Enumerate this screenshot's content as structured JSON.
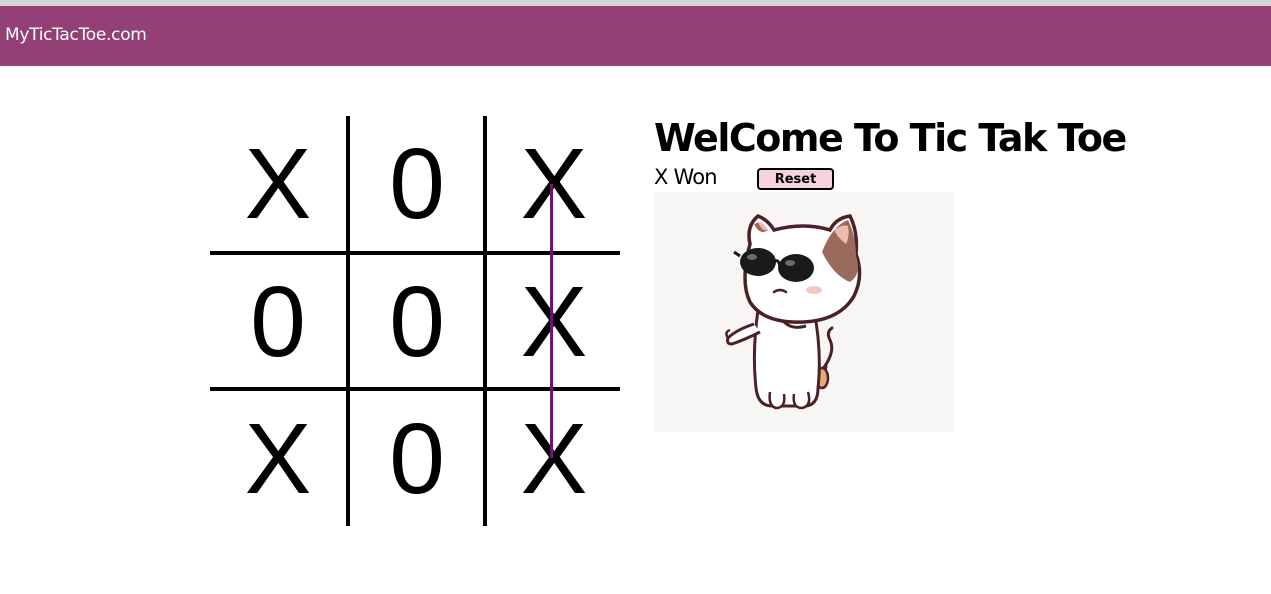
{
  "navbar": {
    "brand": "MyTicTacToe.com",
    "color": "#934077"
  },
  "board": {
    "cells": [
      "X",
      "0",
      "X",
      "0",
      "0",
      "X",
      "X",
      "0",
      "X"
    ],
    "winning_line": {
      "type": "column",
      "index": 2,
      "color": "#7a0a7e"
    }
  },
  "panel": {
    "title": "WelCome To Tic Tak Toe",
    "status": "X Won",
    "reset_label": "Reset",
    "reset_color": "#f5d3de"
  },
  "image": {
    "icon": "cool-cat-sunglasses"
  }
}
